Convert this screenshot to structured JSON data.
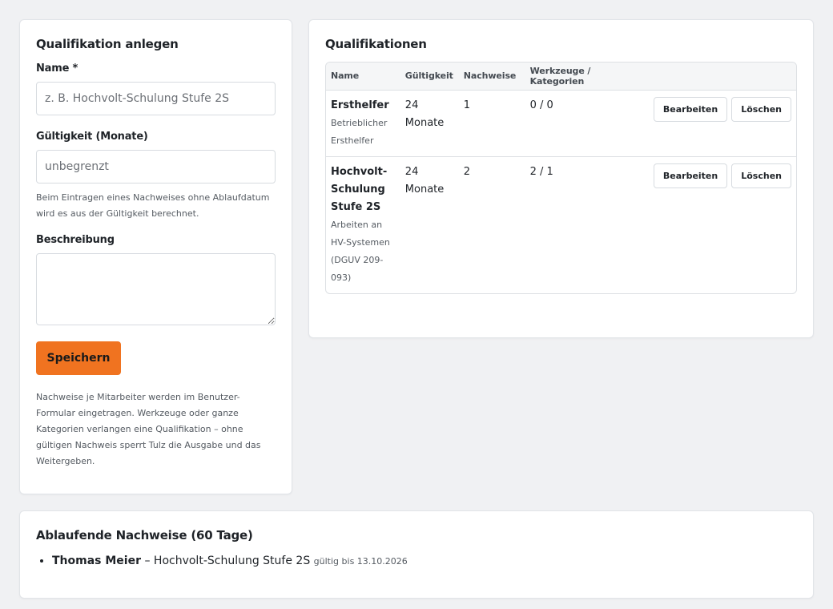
{
  "form": {
    "title": "Qualifikation anlegen",
    "name_label": "Name *",
    "name_placeholder": "z. B. Hochvolt-Schulung Stufe 2S",
    "validity_label": "Gültigkeit (Monate)",
    "validity_placeholder": "unbegrenzt",
    "validity_hint": "Beim Eintragen eines Nachweises ohne Ablaufdatum wird es aus der Gültigkeit berechnet.",
    "description_label": "Beschreibung",
    "description_value": "",
    "save_label": "Speichern",
    "footer_hint": "Nachweise je Mitarbeiter werden im Benutzer-Formular eingetragen. Werkzeuge oder ganze Kategorien verlangen eine Qualifikation – ohne gültigen Nachweis sperrt Tulz die Ausgabe und das Weitergeben."
  },
  "list": {
    "title": "Qualifikationen",
    "columns": [
      "Name",
      "Gültigkeit",
      "Nachweise",
      "Werkzeuge / Kategorien",
      ""
    ],
    "rows": [
      {
        "name": "Ersthelfer",
        "description": "Betrieblicher Ersthelfer",
        "validity": "24 Monate",
        "proofs": "1",
        "tools": "0 / 0",
        "edit": "Bearbeiten",
        "delete": "Löschen"
      },
      {
        "name": "Hochvolt-Schulung Stufe 2S",
        "description": "Arbeiten an HV-Systemen (DGUV 209-093)",
        "validity": "24 Monate",
        "proofs": "2",
        "tools": "2 / 1",
        "edit": "Bearbeiten",
        "delete": "Löschen"
      }
    ]
  },
  "expiring": {
    "title": "Ablaufende Nachweise (60 Tage)",
    "items": [
      {
        "person": "Thomas Meier",
        "separator": " – ",
        "qualification": "Hochvolt-Schulung Stufe 2S",
        "valid_until": "gültig bis 13.10.2026"
      }
    ]
  },
  "colors": {
    "accent": "#f07320",
    "background": "#f0f1f3",
    "card": "#ffffff"
  }
}
